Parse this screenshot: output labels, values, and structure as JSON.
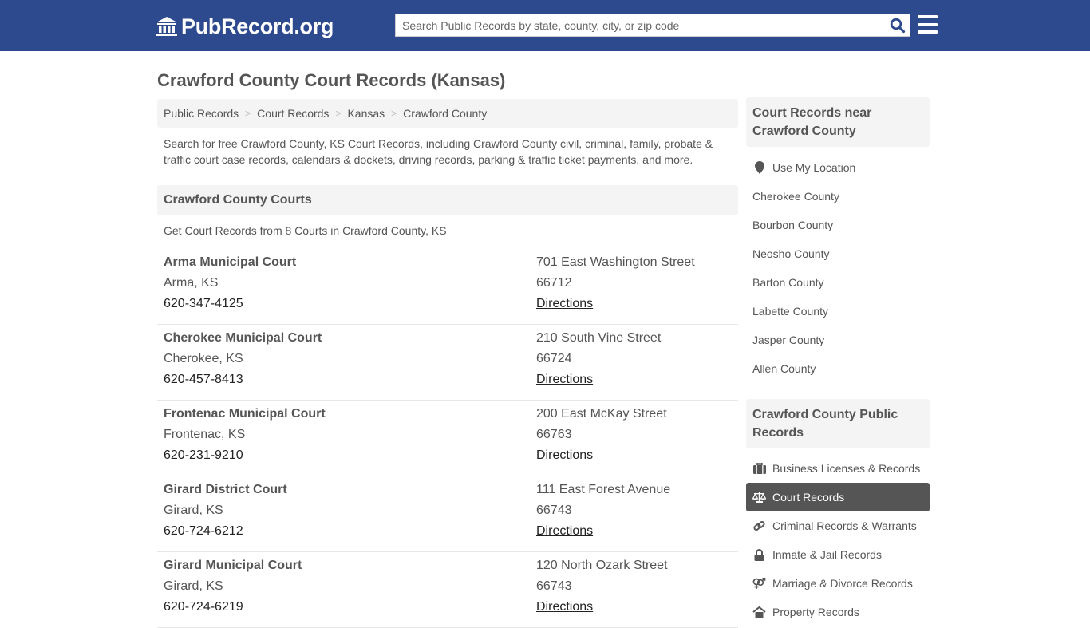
{
  "header": {
    "logo_text": "PubRecord.org",
    "search_placeholder": "Search Public Records by state, county, city, or zip code",
    "search_value": "",
    "brand_color": "#2e4a8e"
  },
  "page": {
    "title": "Crawford County Court Records (Kansas)",
    "breadcrumb": [
      "Public Records",
      "Court Records",
      "Kansas",
      "Crawford County"
    ],
    "intro": "Search for free Crawford County, KS Court Records, including Crawford County civil, criminal, family, probate & traffic court case records, calendars & dockets, driving records, parking & traffic ticket payments, and more.",
    "section_title": "Crawford County Courts",
    "section_subtitle": "Get Court Records from 8 Courts in Crawford County, KS"
  },
  "courts": [
    {
      "name": "Arma Municipal Court",
      "city": "Arma, KS",
      "phone": "620-347-4125",
      "address": "701 East Washington Street",
      "zip": "66712",
      "directions": "Directions"
    },
    {
      "name": "Cherokee Municipal Court",
      "city": "Cherokee, KS",
      "phone": "620-457-8413",
      "address": "210 South Vine Street",
      "zip": "66724",
      "directions": "Directions"
    },
    {
      "name": "Frontenac Municipal Court",
      "city": "Frontenac, KS",
      "phone": "620-231-9210",
      "address": "200 East McKay Street",
      "zip": "66763",
      "directions": "Directions"
    },
    {
      "name": "Girard District Court",
      "city": "Girard, KS",
      "phone": "620-724-6212",
      "address": "111 East Forest Avenue",
      "zip": "66743",
      "directions": "Directions"
    },
    {
      "name": "Girard Municipal Court",
      "city": "Girard, KS",
      "phone": "620-724-6219",
      "address": "120 North Ozark Street",
      "zip": "66743",
      "directions": "Directions"
    }
  ],
  "sidebar": {
    "nearby_title": "Court Records near Crawford County",
    "use_location": "Use My Location",
    "nearby": [
      "Cherokee County",
      "Bourbon County",
      "Neosho County",
      "Barton County",
      "Labette County",
      "Jasper County",
      "Allen County"
    ],
    "public_title": "Crawford County Public Records",
    "public_records": [
      {
        "label": "Business Licenses & Records",
        "icon": "briefcase-icon",
        "active": false
      },
      {
        "label": "Court Records",
        "icon": "scale-icon",
        "active": true
      },
      {
        "label": "Criminal Records & Warrants",
        "icon": "link-icon",
        "active": false
      },
      {
        "label": "Inmate & Jail Records",
        "icon": "lock-icon",
        "active": false
      },
      {
        "label": "Marriage & Divorce Records",
        "icon": "gender-icon",
        "active": false
      },
      {
        "label": "Property Records",
        "icon": "home-icon",
        "active": false
      }
    ]
  }
}
